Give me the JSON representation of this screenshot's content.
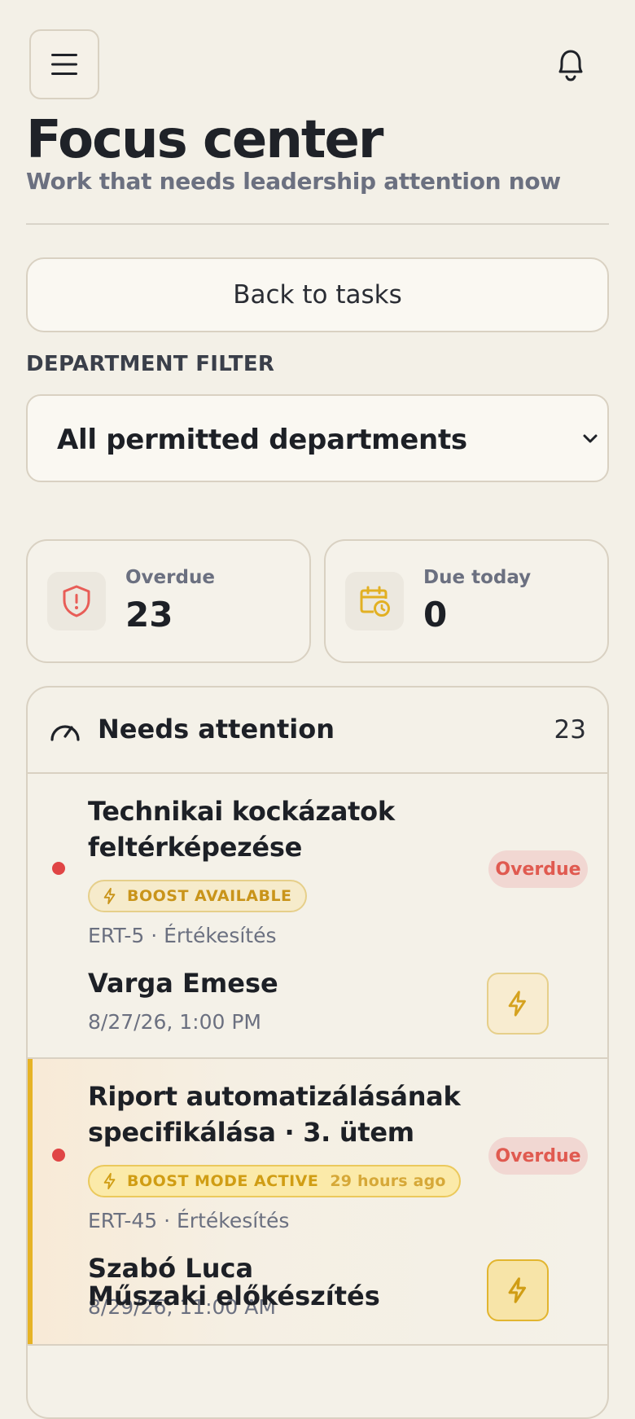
{
  "header": {
    "menu_icon": "hamburger-icon",
    "notifications_icon": "bell-icon",
    "title": "Focus center",
    "subtitle": "Work that needs leadership attention now"
  },
  "actions": {
    "back_label": "Back to tasks"
  },
  "filter": {
    "label": "DEPARTMENT FILTER",
    "selected": "All permitted departments"
  },
  "stats": [
    {
      "label": "Overdue",
      "value": "23",
      "icon": "shield-alert-icon",
      "color": "#e85d57"
    },
    {
      "label": "Due today",
      "value": "0",
      "icon": "calendar-clock-icon",
      "color": "#e2b023"
    }
  ],
  "attention": {
    "title": "Needs attention",
    "count": "23",
    "icon": "gauge-icon",
    "tasks": [
      {
        "title_line1": "Technikai kockázatok",
        "title_line2": "feltérképezése",
        "badge": "BOOST AVAILABLE",
        "badge_time": "",
        "meta": "ERT-5 · Értékesítés",
        "status": "Overdue",
        "assignee": "Varga Emese",
        "due": "8/27/26, 1:00 PM",
        "boost_active": false
      },
      {
        "title_line1": "Riport automatizálásának",
        "title_line2": "specifikálása · 3. ütem",
        "badge": "BOOST MODE ACTIVE",
        "badge_time": "29 hours ago",
        "meta": "ERT-45 · Értékesítés",
        "status": "Overdue",
        "assignee": "Szabó Luca",
        "due": "8/29/26, 11:00 AM",
        "boost_active": true
      }
    ],
    "partial_next_title": "Műszaki előkészítés"
  },
  "colors": {
    "background": "#f3f0e7",
    "overdue": "#e05a50",
    "boost": "#e2b52f",
    "dot": "#e04545"
  }
}
